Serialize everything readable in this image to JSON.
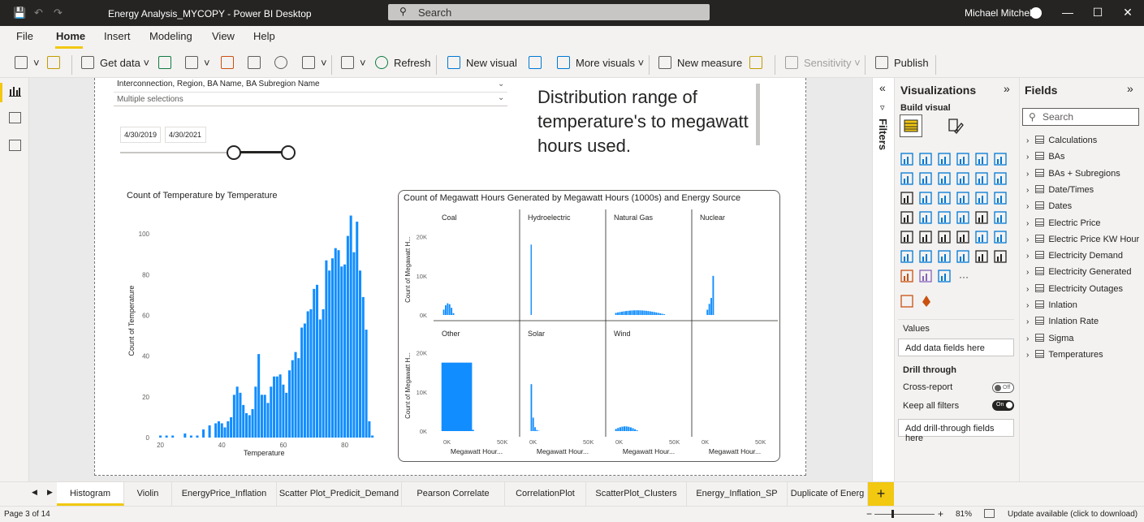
{
  "titlebar": {
    "title": "Energy Analysis_MYCOPY - Power BI Desktop",
    "search": "Search",
    "user": "Michael Mitchell"
  },
  "menu": [
    "File",
    "Home",
    "Insert",
    "Modeling",
    "View",
    "Help"
  ],
  "ribbon": {
    "get_data": "Get data",
    "refresh": "Refresh",
    "new_visual": "New visual",
    "more_visuals": "More visuals",
    "new_measure": "New measure",
    "sensitivity": "Sensitivity",
    "publish": "Publish"
  },
  "slicer": {
    "label": "Interconnection, Region, BA Name, BA Subregion Name",
    "value": "Multiple selections",
    "date_start": "4/30/2019",
    "date_end": "4/30/2021",
    "range_low": 0.67,
    "range_high": 1.0
  },
  "textbox": "Distribution range of temperature's to megawatt hours used.",
  "chart_data": [
    {
      "type": "bar",
      "title": "Count of Temperature by Temperature",
      "xlabel": "Temperature",
      "ylabel": "Count of Temperature",
      "xlim": [
        18,
        92
      ],
      "ylim": [
        0,
        112
      ],
      "xticks": [
        "20",
        "40",
        "60",
        "80"
      ],
      "yticks": [
        "0",
        "20",
        "40",
        "60",
        "80",
        "100"
      ],
      "x": [
        20,
        22,
        24,
        28,
        30,
        32,
        34,
        36,
        38,
        39,
        40,
        41,
        42,
        43,
        44,
        45,
        46,
        47,
        48,
        49,
        50,
        51,
        52,
        53,
        54,
        55,
        56,
        57,
        58,
        59,
        60,
        61,
        62,
        63,
        64,
        65,
        66,
        67,
        68,
        69,
        70,
        71,
        72,
        73,
        74,
        75,
        76,
        77,
        78,
        79,
        80,
        81,
        82,
        83,
        84,
        85,
        86,
        87,
        88,
        89
      ],
      "values": [
        1,
        1,
        1,
        2,
        1,
        1,
        4,
        6,
        7,
        8,
        7,
        5,
        8,
        10,
        21,
        25,
        22,
        16,
        12,
        11,
        14,
        25,
        41,
        21,
        21,
        17,
        25,
        30,
        30,
        31,
        26,
        22,
        33,
        38,
        42,
        39,
        54,
        56,
        62,
        63,
        73,
        75,
        58,
        63,
        87,
        82,
        88,
        93,
        92,
        84,
        85,
        99,
        109,
        91,
        106,
        82,
        69,
        53,
        8,
        1
      ],
      "bar_color": "#118dff"
    },
    {
      "type": "bar",
      "title": "Count of Megawatt Hours Generated by Megawatt Hours (1000s) and Energy Source",
      "xlabel": "Megawatt Hour...",
      "ylabel": "Count of Megawatt H...",
      "yticks": [
        "0K",
        "10K",
        "20K"
      ],
      "xticks": [
        "0K",
        "50K"
      ],
      "panels": [
        {
          "name": "Coal",
          "shape": "hump",
          "peak": 3.0,
          "start": 0.08,
          "width": 0.15
        },
        {
          "name": "Hydroelectric",
          "shape": "spike",
          "peak": 18.0,
          "start": 0.1,
          "width": 0.02
        },
        {
          "name": "Natural Gas",
          "shape": "hump",
          "peak": 1.2,
          "start": 0.08,
          "width": 0.65
        },
        {
          "name": "Nuclear",
          "shape": "spikes",
          "peak": 10.0,
          "start": 0.15,
          "width": 0.1
        },
        {
          "name": "Other",
          "shape": "spike",
          "peak": 17.5,
          "start": 0.06,
          "width": 0.4
        },
        {
          "name": "Solar",
          "shape": "decay",
          "peak": 12.0,
          "start": 0.1,
          "width": 0.12
        },
        {
          "name": "Wind",
          "shape": "hump",
          "peak": 1.2,
          "start": 0.08,
          "width": 0.3
        }
      ],
      "ymax": 22,
      "bar_color": "#118dff"
    }
  ],
  "visualizations": {
    "title": "Visualizations",
    "build": "Build visual",
    "values": "Values",
    "add_data": "Add data fields here",
    "drill": "Drill through",
    "cross_report": "Cross-report",
    "cross_state": "Off",
    "keep_filters": "Keep all filters",
    "keep_state": "On",
    "add_drill": "Add drill-through fields here"
  },
  "filters": {
    "label": "Filters"
  },
  "fields": {
    "title": "Fields",
    "search": "Search",
    "items": [
      "Calculations",
      "BAs",
      "BAs + Subregions",
      "Date/Times",
      "Dates",
      "Electric Price",
      "Electric Price KW Hour",
      "Electricity Demand",
      "Electricity Generated",
      "Electricity Outages",
      "Inlation",
      "Inlation Rate",
      "Sigma",
      "Temperatures"
    ]
  },
  "tabs": [
    "Histogram",
    "Violin",
    "EnergyPrice_Inflation",
    "Scatter Plot_Predicit_Demand",
    "Pearson Correlate",
    "CorrelationPlot",
    "ScatterPlot_Clusters",
    "Energy_Inflation_SP",
    "Duplicate of Energ"
  ],
  "status": {
    "page": "Page 3 of 14",
    "zoom": "81%",
    "update": "Update available (click to download)"
  }
}
